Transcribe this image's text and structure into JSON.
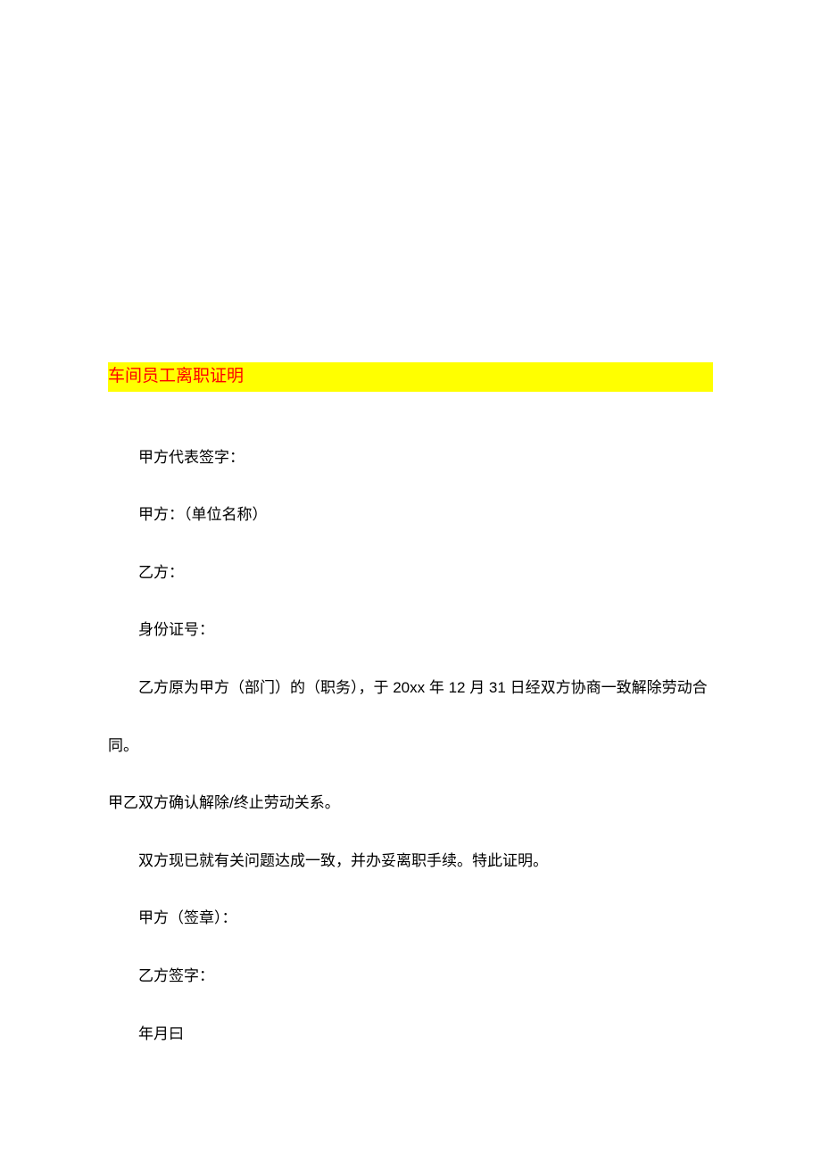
{
  "title": "车间员工离职证明",
  "paragraphs": {
    "p1": "甲方代表签字：",
    "p2": "甲方：（单位名称）",
    "p3": "乙方：",
    "p4": "身份证号：",
    "p5": "乙方原为甲方（部门）的（职务），于 20xx 年 12 月 31 日经双方协商一致解除劳动合同。",
    "p5b": "甲乙双方确认解除/终止劳动关系。",
    "p6": "双方现已就有关问题达成一致，并办妥离职手续。特此证明。",
    "p7": "甲方（签章）：",
    "p8": "乙方签字：",
    "p9": "年月曰"
  }
}
